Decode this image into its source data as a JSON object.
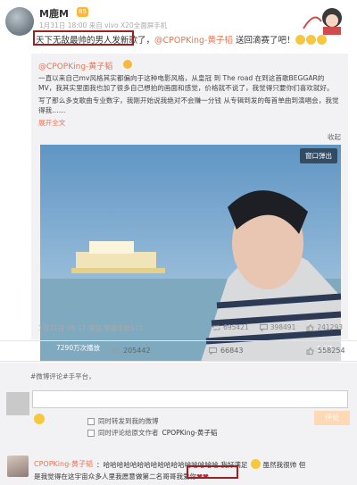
{
  "post": {
    "username": "M鹿M",
    "vip_badge": "85",
    "meta": "1月31日 18:00 来自 vivo X20全面屏手机",
    "text_highlight": "天下无敌最帅的男人",
    "text_mid": "发新歌了，",
    "mention": "@CPOPKing-黄子韬",
    "text_end": " 送回滴赛了吧！"
  },
  "repost": {
    "author": "@CPOPKing-黄子韬",
    "paragraph1": "一直以来自己mv风格其实都偏向于这种电影风格，从皇冠 到 The road 在到这首歌BEGGAR的 MV，我其实里面我也加了很多自己想拍的画面和感觉，价格就不说了，我觉得只要你们喜欢就好。",
    "paragraph2": "写了那么多支歌曲专业数字，我刚开始说我绝对不会赚一分钱 从专辑到发的每首单曲到演唱会，我觉得我……",
    "more_link": "展开全文",
    "collapse": "收起",
    "popout": "窗口弹出",
    "views": "7290万次播放",
    "duration": "5:17",
    "meta": "1月31日 09:17 来自 荣耀手机S11",
    "stats": {
      "repost": "695421",
      "comment": "398491",
      "like": "241293"
    }
  },
  "actions": {
    "repost": "205442",
    "comment": "66843",
    "like": "558254"
  },
  "comment_box": {
    "tip": "#微博评论#手平台，",
    "input_value": "",
    "option1": "同时转发到我的微博",
    "option2_prefix": "同时评论给原文作者",
    "option2_user": "CPOPKing-黄子韬",
    "submit_label": "评论"
  },
  "comment": {
    "author": "CPOPKing-黄子韬",
    "vip": "68",
    "line1": "：哈哈哈哈哈哈哈哈哈哈哈哈哈哈哈哈哈  我好满足",
    "line1_end": " 虽然我很帅 但",
    "line2": "是我觉得在这宇宙众多人里我愿意做第二名哥哥",
    "line2_highlight": "我爱你",
    "hearts": "❤❤"
  },
  "colors": {
    "accent": "#eb7350",
    "highlight_box": "#9b2222",
    "background_panel": "#f2f2f5"
  }
}
